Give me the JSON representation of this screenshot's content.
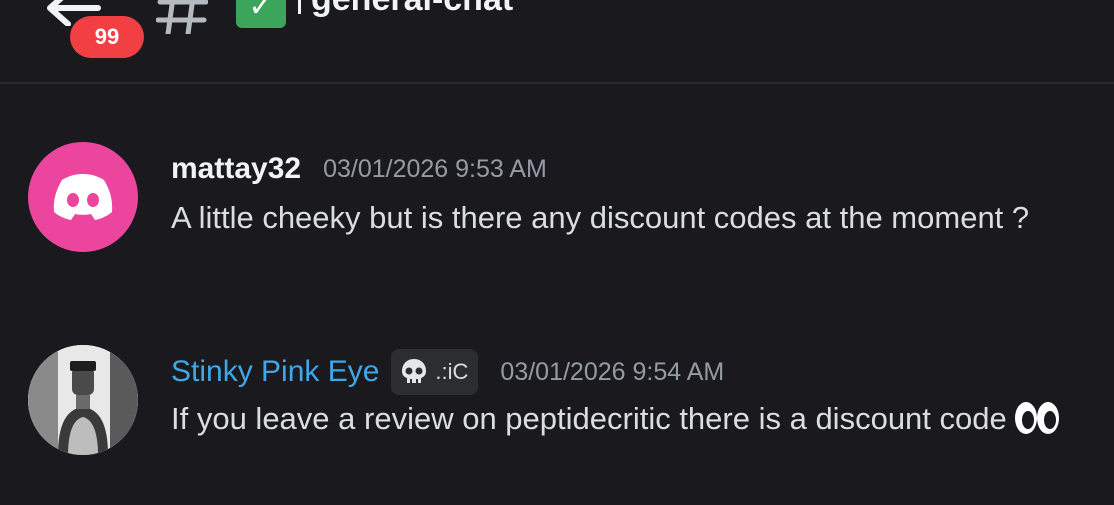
{
  "header": {
    "unread_badge": "99",
    "channel_prefix_icon": "hash-icon",
    "channel_emoji_icon": "check-mark-button-icon",
    "channel_name": "general-chat"
  },
  "messages": [
    {
      "username": "mattay32",
      "username_color": "#f2f3f5",
      "avatar": "discord-logo-icon",
      "avatar_color": "#eb459e",
      "timestamp": "03/01/2026 9:53 AM",
      "text": "A little cheeky but is there any discount codes at the moment ?"
    },
    {
      "username": "Stinky Pink Eye",
      "username_color": "#3fa7e8",
      "avatar": "profile-photo",
      "tag_icon": "skull-icon",
      "tag_text": ".:iC",
      "timestamp": "03/01/2026 9:54 AM",
      "text": "If you leave a review on peptidecritic there is a discount code",
      "trailing_emoji": "eyes-icon"
    }
  ],
  "colors": {
    "background": "#1a1a1e",
    "badge": "#f23f43",
    "timestamp": "#949ba4",
    "body_text": "#dbdee1"
  }
}
